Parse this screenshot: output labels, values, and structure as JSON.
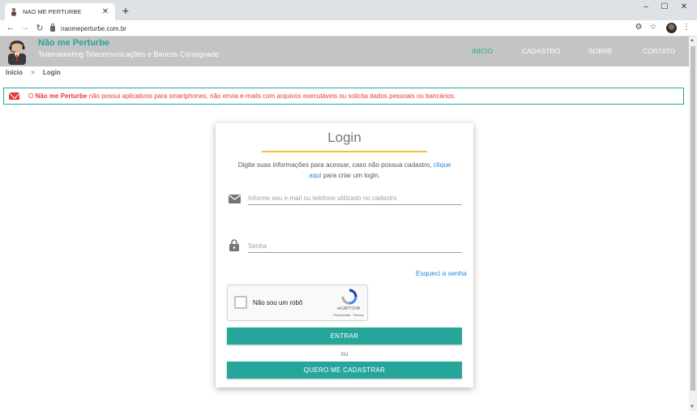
{
  "browser": {
    "tab_title": "NAO ME PERTURBE",
    "tab_close": "✕",
    "new_tab": "+",
    "url": "naomeperturbe.com.br",
    "window_controls": [
      "–",
      "☐",
      "✕"
    ]
  },
  "site": {
    "brand_title": "Não me Perturbe",
    "brand_subtitle": "Telemarketing Telecomunicações e Bancos Consignado",
    "nav": [
      {
        "label": "INÍCIO",
        "active": true
      },
      {
        "label": "CADASTRO",
        "active": false
      },
      {
        "label": "SOBRE",
        "active": false
      },
      {
        "label": "CONTATO",
        "active": false
      }
    ],
    "accent_color": "#26a69a",
    "header_color": "#c4c4c4"
  },
  "breadcrumb": {
    "home": "Início",
    "separator": ">",
    "current": "Login"
  },
  "alert": {
    "prefix": "O ",
    "brand": "Não me Perturbe",
    "message": " não possui aplicativos para smartphones, não envia e-mails com arquivos executáveis ou solicita dados pessoais ou bancários.",
    "icon": "mail-icon",
    "color": "#e53935"
  },
  "login": {
    "title": "Login",
    "intro_text": "Digite suas informações para acessar, caso não possua cadastro, ",
    "intro_link_1": "clique",
    "intro_link_2": "aqui",
    "intro_suffix": " para criar um login.",
    "email_placeholder": "Informe seu e-mail ou telefone utilizado no cadastro",
    "email_value": "",
    "password_placeholder": "Senha",
    "password_value": "",
    "forgot_label": "Esqueci a senha",
    "recaptcha_label": "Não sou um robô",
    "recaptcha_brand": "reCAPTCHA",
    "recaptcha_links": "Privacidade - Termos",
    "submit_label": "ENTRAR",
    "or_label": "ou",
    "register_label": "QUERO ME CADASTRAR"
  }
}
